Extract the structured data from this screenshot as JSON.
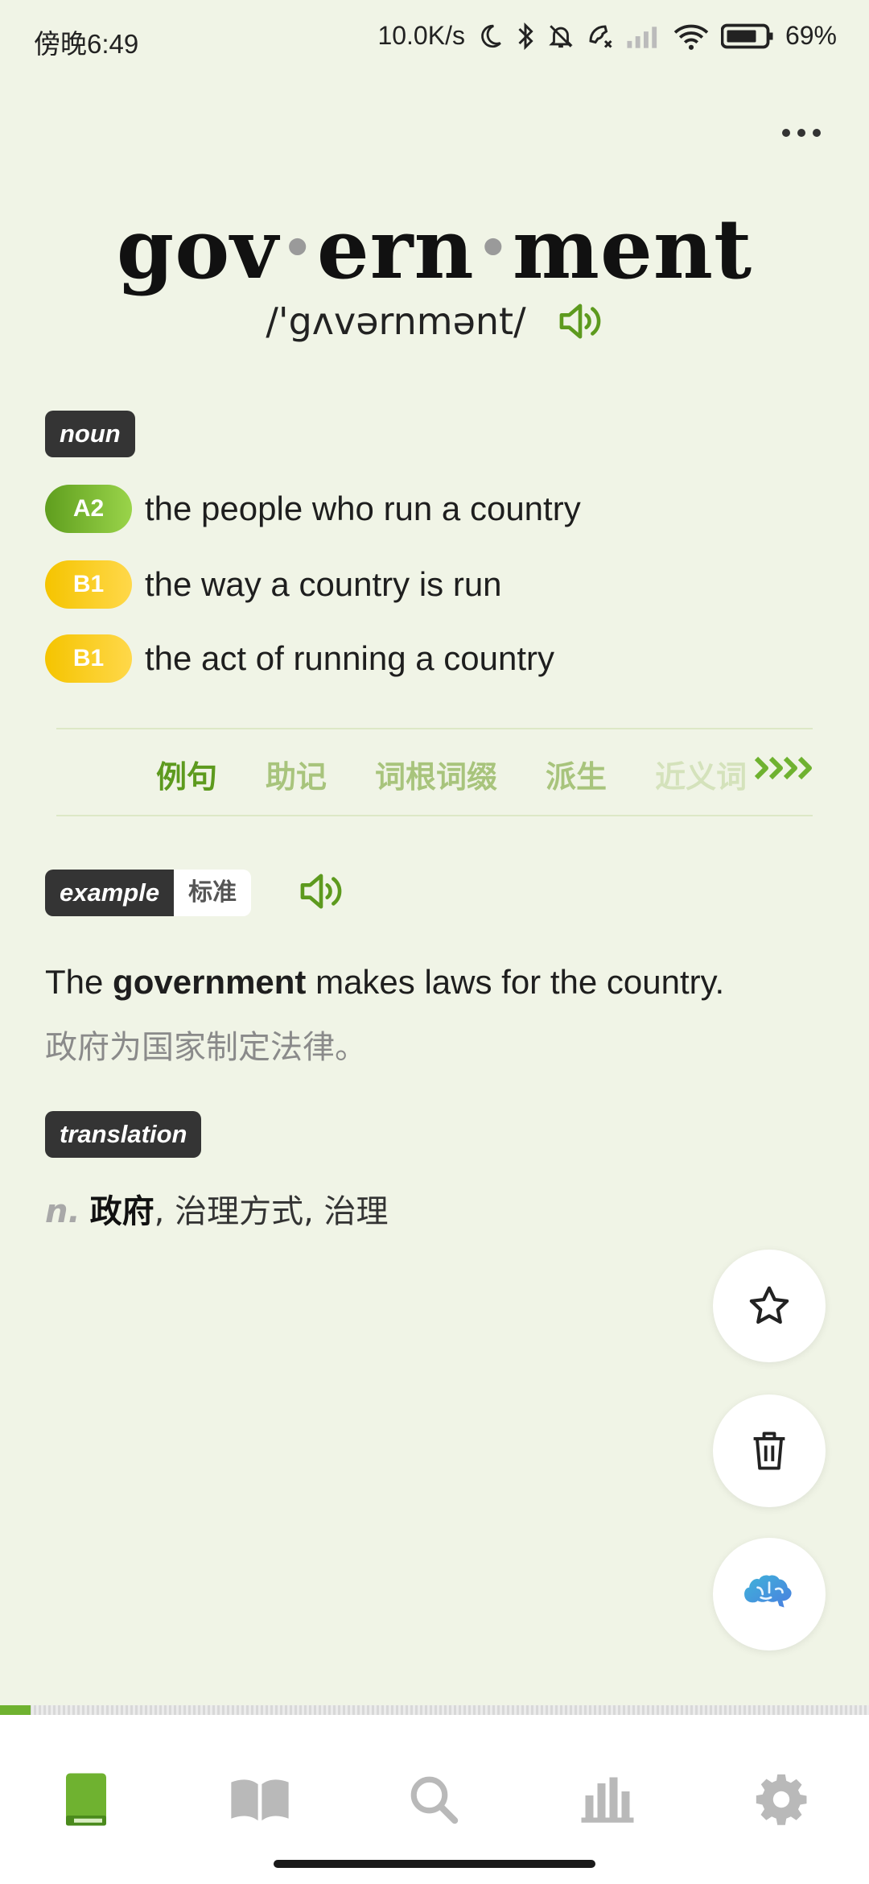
{
  "status_bar": {
    "time": "傍晚6:49",
    "net_speed": "10.0K/s",
    "battery": "69%"
  },
  "word": {
    "syllables": [
      "gov",
      "ern",
      "ment"
    ],
    "phonetic": "/'gʌvərnmənt/"
  },
  "pos_tag": "noun",
  "senses": [
    {
      "level": "A2",
      "text": "the people who run a country"
    },
    {
      "level": "B1",
      "text": "the way a country is run"
    },
    {
      "level": "B1",
      "text": "the act of running a country"
    }
  ],
  "tabs": [
    "例句",
    "助记",
    "词根词缀",
    "派生",
    "近义词"
  ],
  "example": {
    "tag": "example",
    "tag_sub": "标准",
    "en_prefix": "The ",
    "en_bold": "government",
    "en_suffix": " makes laws for the country.",
    "zh": "政府为国家制定法律。"
  },
  "translation": {
    "tag": "translation",
    "pos": "n.",
    "main": "政府",
    "rest": ", 治理方式, 治理"
  },
  "progress": 0.035,
  "colors": {
    "background": "#f0f4e6",
    "accent_green": "#5d9a1e",
    "level_a2": "#6fb230",
    "level_b1": "#f7c800",
    "tag_dark": "#343434"
  },
  "icons": {
    "more": "more-dots-icon",
    "speaker": "speaker-icon",
    "star": "star-icon",
    "trash": "trash-icon",
    "brain": "brain-icon",
    "nav": [
      "book-icon",
      "open-book-icon",
      "search-icon",
      "bar-chart-icon",
      "gear-icon"
    ]
  }
}
